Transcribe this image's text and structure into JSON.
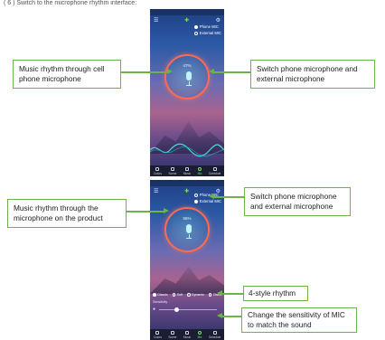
{
  "heading": "( 6 ) Switch to the microphone rhythm interface:",
  "colors": {
    "callout_border": "#6cb44a",
    "ring": "#ff6a52"
  },
  "screen1": {
    "radio_options": [
      "Phone MIC",
      "External MIC"
    ],
    "selected_radio": 0,
    "level_text": "47%",
    "tabs": [
      "Colors",
      "Scene",
      "Music",
      "Mic",
      "Schedule"
    ],
    "active_tab": 3
  },
  "screen2": {
    "radio_options": [
      "Phone MIC",
      "External MIC"
    ],
    "selected_radio": 1,
    "level_text": "56%",
    "style_options": [
      "Classic",
      "Soft",
      "Dynamic",
      "Disco"
    ],
    "selected_style": 0,
    "sensitivity_label": "Sensitivity",
    "sensitivity_level": 0.3,
    "tabs": [
      "Colors",
      "Scene",
      "Music",
      "Mic",
      "Schedule"
    ],
    "active_tab": 3
  },
  "callouts": {
    "music_rhythm_phone": "Music rhythm through cell phone microphone",
    "switch_mic_1": "Switch phone microphone and external microphone",
    "music_rhythm_product": "Music rhythm through the microphone on the product",
    "switch_mic_2": "Switch phone microphone and external microphone",
    "four_style": "4-style rhythm",
    "sensitivity": "Change the sensitivity of MIC to match the sound"
  }
}
